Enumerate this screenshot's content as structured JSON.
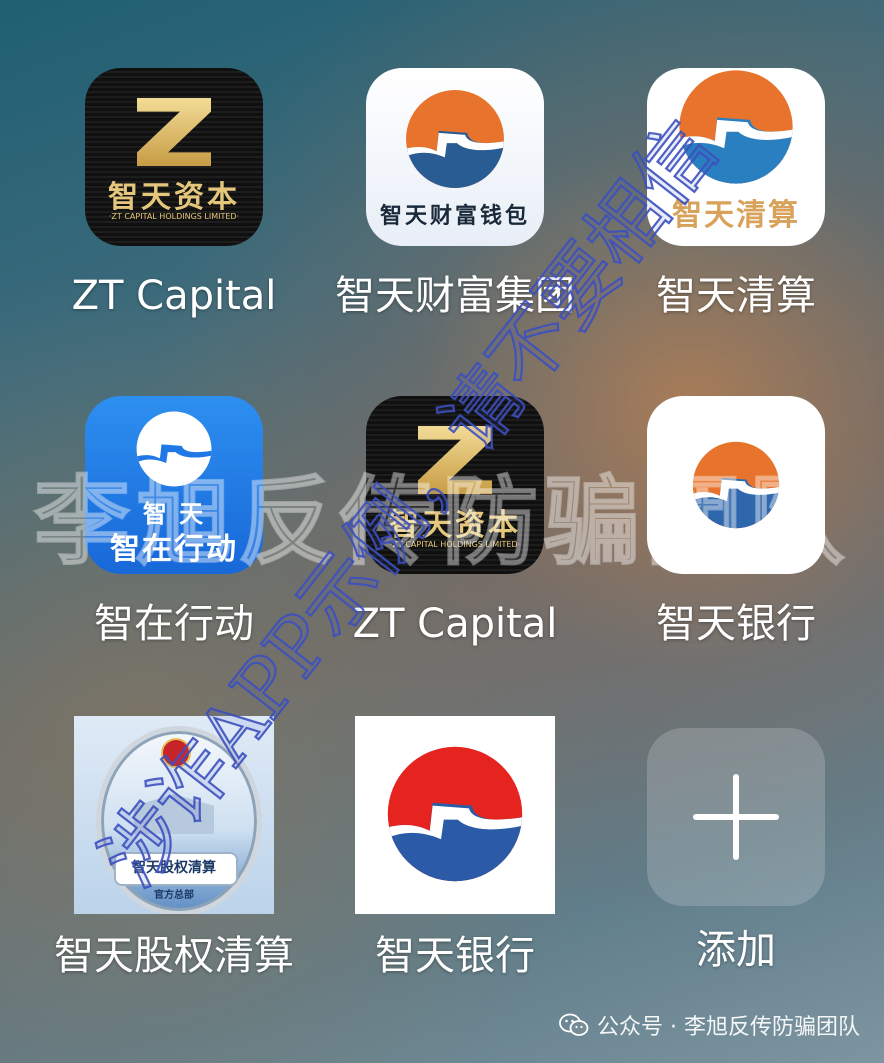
{
  "apps": [
    {
      "label": "ZT Capital",
      "icon_logo": "ZT",
      "icon_cn": "智天资本",
      "icon_en": "·ZT CAPITAL HOLDINGS LIMITED·"
    },
    {
      "label": "智天财富集团",
      "icon_text": "智天财富钱包"
    },
    {
      "label": "智天清算",
      "icon_text": "智天清算"
    },
    {
      "label": "智在行动",
      "icon_text_1": "智 天",
      "icon_text_2": "智在行动"
    },
    {
      "label": "ZT Capital",
      "icon_logo": "ZT",
      "icon_cn": "智天资本",
      "icon_en": "·ZT CAPITAL HOLDINGS LIMITED·"
    },
    {
      "label": "智天银行"
    },
    {
      "label": "智天股权清算",
      "icon_text": "智天股权清算",
      "icon_sub": "官方总部"
    },
    {
      "label": "智天银行"
    },
    {
      "label": "添加"
    }
  ],
  "watermark": {
    "line1": "李旭反传防骗团队",
    "line2": "涉诈APP示例，请不要相信"
  },
  "footer": {
    "text": "公众号 · 李旭反传防骗团队"
  },
  "colors": {
    "logo_orange": "#e8732c",
    "logo_blue": "#2a5c94",
    "logo_red": "#e52420",
    "bank_blue": "#2f67ad",
    "gold": "#e4c77b"
  }
}
